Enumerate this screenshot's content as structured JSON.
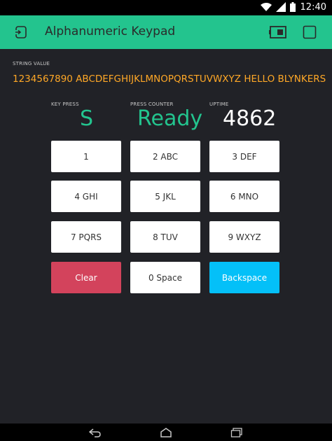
{
  "status": {
    "time": "12:40"
  },
  "app": {
    "title": "Alphanumeric Keypad"
  },
  "string_value": {
    "label": "STRING VALUE",
    "value": "1234567890 ABCDEFGHIJKLMNOPQRSTUVWXYZ HELLO BLYNKERS"
  },
  "displays": {
    "key_press": {
      "label": "KEY PRESS",
      "value": "S"
    },
    "press_counter": {
      "label": "PRESS COUNTER",
      "value": "Ready"
    },
    "uptime": {
      "label": "UPTIME",
      "value": "4862"
    }
  },
  "keys": [
    "1",
    "2 ABC",
    "3 DEF",
    "4 GHI",
    "5 JKL",
    "6 MNO",
    "7 PQRS",
    "8 TUV",
    "9 WXYZ",
    "Clear",
    "0 Space",
    "Backspace"
  ],
  "colors": {
    "accent": "#23c48e",
    "string_value": "#ffa827",
    "clear": "#d3435c",
    "backspace": "#04c0f8",
    "background": "#212227"
  }
}
